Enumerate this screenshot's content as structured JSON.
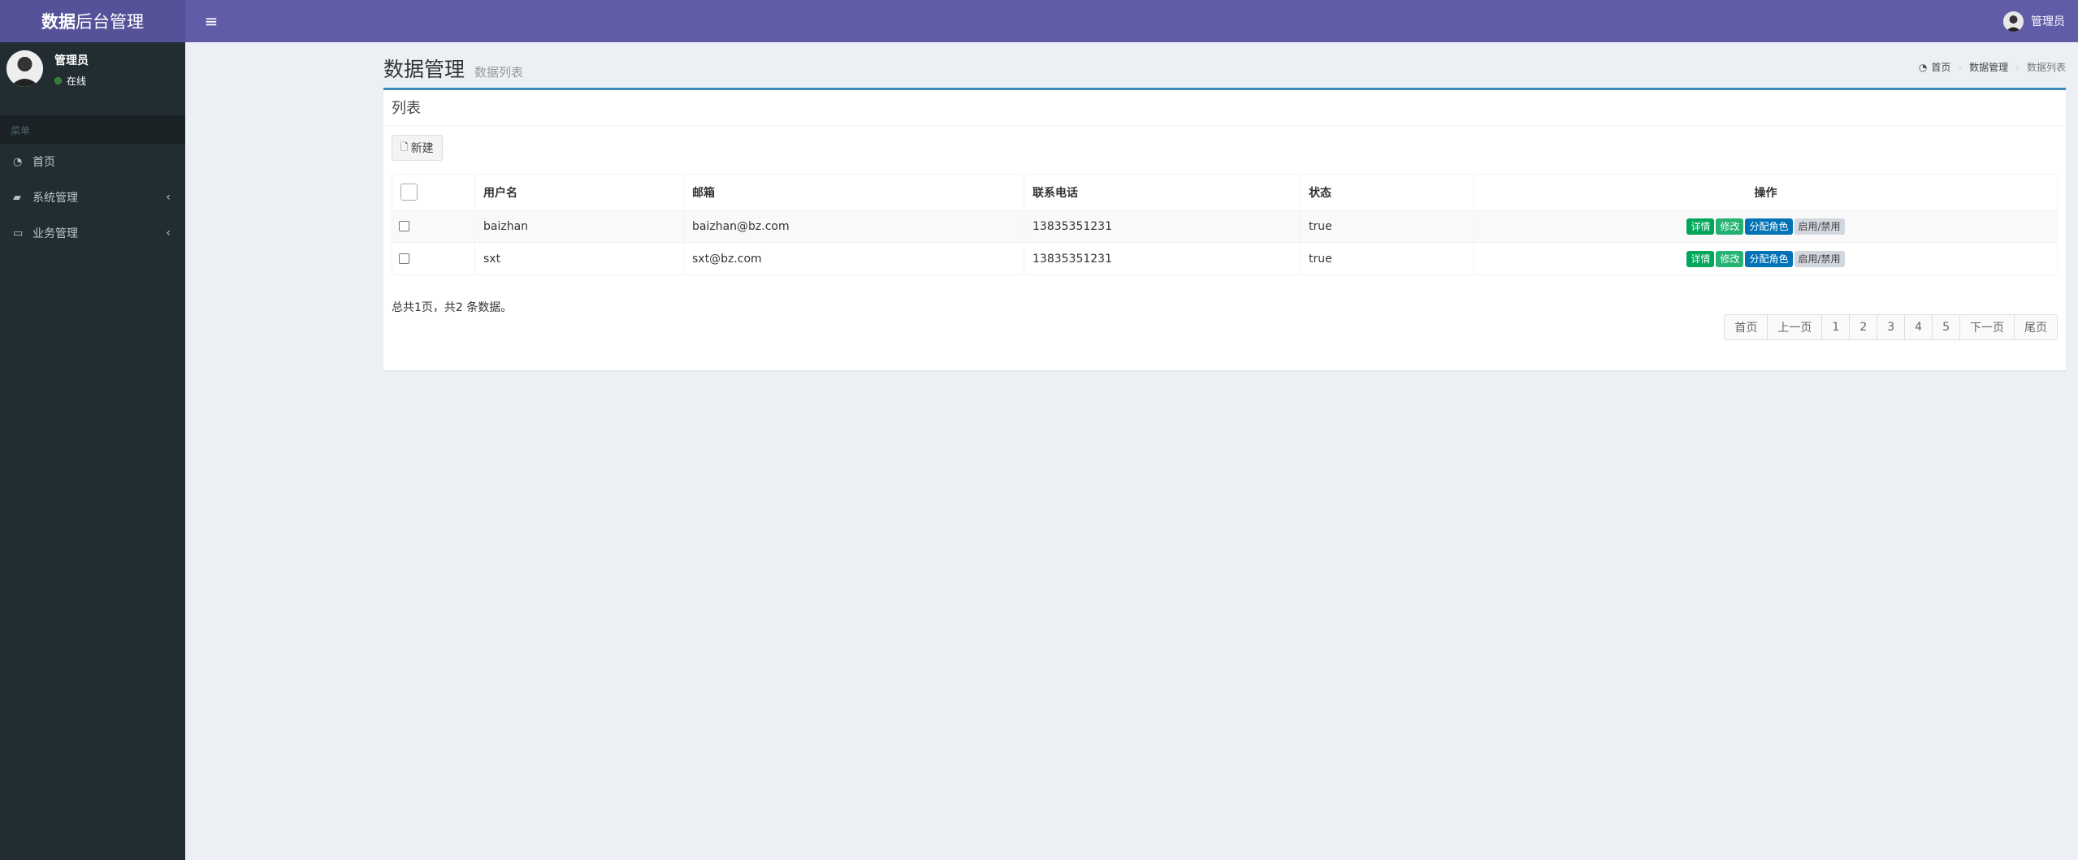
{
  "app": {
    "logo_bold": "数据",
    "logo_rest": "后台管理"
  },
  "topbar": {
    "user_name": "管理员"
  },
  "sidebar": {
    "user_name": "管理员",
    "user_status": "在线",
    "menu_header": "菜单",
    "items": [
      {
        "label": "首页",
        "icon": "dashboard-icon"
      },
      {
        "label": "系统管理",
        "icon": "folder-icon"
      },
      {
        "label": "业务管理",
        "icon": "laptop-icon"
      }
    ]
  },
  "page": {
    "title": "数据管理",
    "subtitle": "数据列表"
  },
  "breadcrumb": {
    "home": "首页",
    "section": "数据管理",
    "current": "数据列表"
  },
  "box": {
    "title": "列表",
    "new_button": "新建"
  },
  "table": {
    "headers": {
      "username": "用户名",
      "email": "邮箱",
      "phone": "联系电话",
      "status": "状态",
      "actions": "操作"
    },
    "rows": [
      {
        "username": "baizhan",
        "email": "baizhan@bz.com",
        "phone": "13835351231",
        "status": "true"
      },
      {
        "username": "sxt",
        "email": "sxt@bz.com",
        "phone": "13835351231",
        "status": "true"
      }
    ],
    "actions": {
      "detail": "详情",
      "edit": "修改",
      "assign_role": "分配角色",
      "toggle": "启用/禁用"
    }
  },
  "summary": "总共1页，共2 条数据。",
  "pagination": {
    "first": "首页",
    "prev": "上一页",
    "pages": [
      "1",
      "2",
      "3",
      "4",
      "5"
    ],
    "next": "下一页",
    "last": "尾页"
  },
  "colors": {
    "topbar": "#605ca8",
    "sidebar": "#222d32",
    "accent": "#3c8dbc",
    "success": "#00a65a",
    "primary": "#0073b7"
  }
}
